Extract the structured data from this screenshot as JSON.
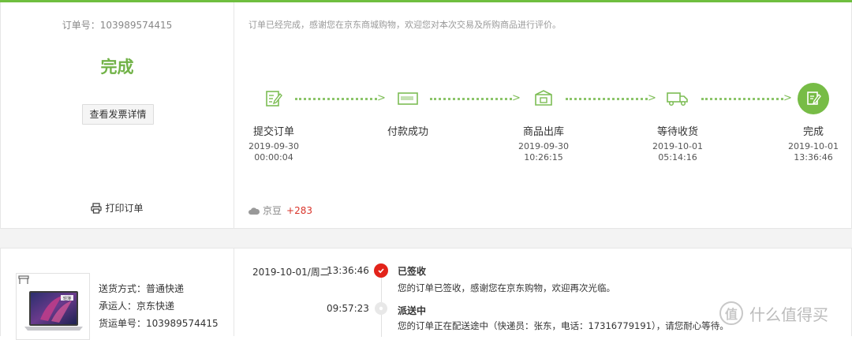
{
  "order": {
    "number_label": "订单号：103989574415",
    "status": "完成",
    "invoice_button": "查看发票详情",
    "print_label": "打印订单",
    "thanks_message": "订单已经完成，感谢您在京东商城购物，欢迎您对本次交易及所购商品进行评价。",
    "beans_label": "京豆",
    "beans_value": "+283",
    "accent_color": "#71b247"
  },
  "steps": [
    {
      "name": "提交订单",
      "date": "2019-09-30",
      "time": "00:00:04",
      "icon": "edit-order-icon"
    },
    {
      "name": "付款成功",
      "date": "",
      "time": "",
      "icon": "payment-card-icon"
    },
    {
      "name": "商品出库",
      "date": "2019-09-30",
      "time": "10:26:15",
      "icon": "package-box-icon"
    },
    {
      "name": "等待收货",
      "date": "2019-10-01",
      "time": "05:14:16",
      "icon": "delivery-truck-icon"
    },
    {
      "name": "完成",
      "date": "2019-10-01",
      "time": "13:36:46",
      "icon": "completed-check-icon"
    }
  ],
  "shipping": {
    "method": "送货方式：普通快递",
    "carrier": "承运人：京东快递",
    "tracking": "货运单号：103989574415",
    "product_badge": "轻薄"
  },
  "tracking": {
    "date": "2019-10-01/周二",
    "events": [
      {
        "time": "13:36:46",
        "title": "已签收",
        "desc": "您的订单已签收，感谢您在京东购物，欢迎再次光临。"
      },
      {
        "time": "09:57:23",
        "title": "派送中",
        "desc": "您的订单正在配送途中（快递员：张东，电话：17316779191），请您耐心等待。"
      }
    ]
  },
  "watermark": {
    "mark": "值",
    "text": "什么值得买"
  }
}
